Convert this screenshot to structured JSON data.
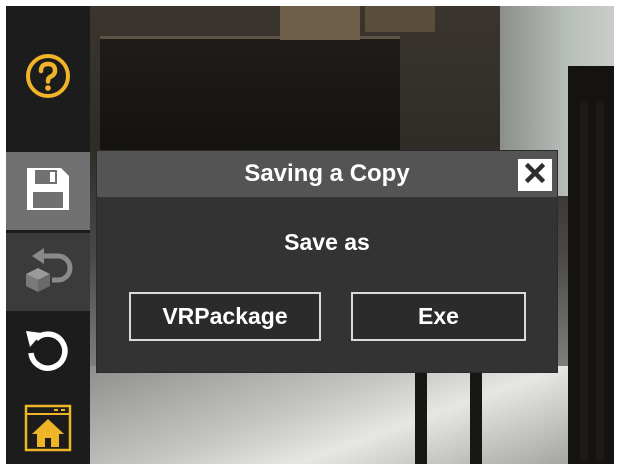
{
  "toolbar": {
    "items": [
      {
        "icon": "help-icon",
        "label": ""
      },
      {
        "icon": "save-icon",
        "label": ""
      },
      {
        "icon": "undo-package-icon",
        "label": ""
      },
      {
        "icon": "reset-icon",
        "label": ""
      },
      {
        "icon": "home-icon",
        "label": ""
      }
    ],
    "accent_color": "#f0b429"
  },
  "dialog": {
    "title": "Saving a Copy",
    "prompt": "Save as",
    "options": [
      {
        "label": "VRPackage"
      },
      {
        "label": "Exe"
      }
    ],
    "close_icon": "close-icon"
  }
}
